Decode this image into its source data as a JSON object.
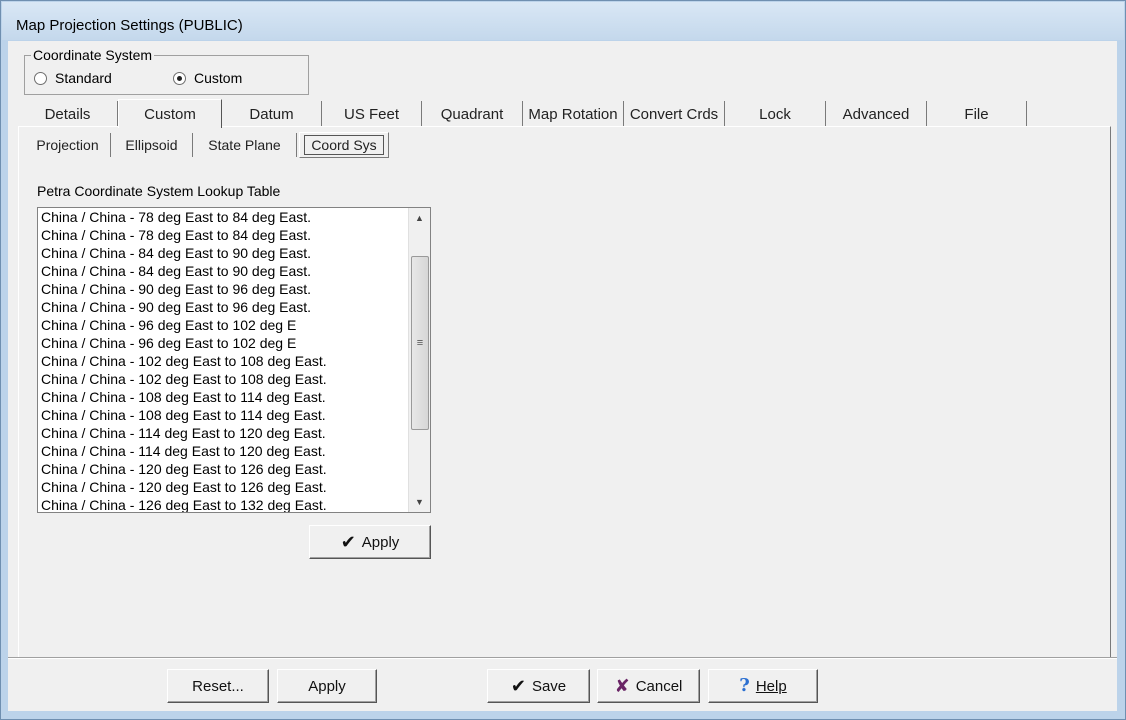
{
  "window": {
    "title": "Map Projection Settings (PUBLIC)"
  },
  "coordinate_system": {
    "label": "Coordinate System",
    "options": [
      {
        "label": "Standard",
        "selected": false
      },
      {
        "label": "Custom",
        "selected": true
      }
    ]
  },
  "tabs": [
    {
      "label": "Details",
      "active": false
    },
    {
      "label": "Custom",
      "active": true
    },
    {
      "label": "Datum",
      "active": false
    },
    {
      "label": "US Feet",
      "active": false
    },
    {
      "label": "Quadrant",
      "active": false
    },
    {
      "label": "Map Rotation",
      "active": false
    },
    {
      "label": "Convert Crds",
      "active": false
    },
    {
      "label": "Lock",
      "active": false
    },
    {
      "label": "Advanced",
      "active": false
    },
    {
      "label": "File",
      "active": false
    }
  ],
  "subtabs": [
    {
      "label": "Projection",
      "active": false
    },
    {
      "label": "Ellipsoid",
      "active": false
    },
    {
      "label": "State Plane",
      "active": false
    },
    {
      "label": "Coord Sys",
      "active": true
    }
  ],
  "lookup": {
    "label": "Petra Coordinate System Lookup Table",
    "items": [
      "China / China - 78 deg East to 84 deg East.",
      "China / China - 78 deg East to 84 deg East.",
      "China / China - 84 deg East to 90 deg East.",
      "China / China - 84 deg East to 90 deg East.",
      "China / China - 90 deg East to 96 deg East.",
      "China / China - 90 deg East to 96 deg East.",
      "China / China - 96 deg East to 102 deg E",
      "China / China - 96 deg East to 102 deg E",
      "China / China - 102 deg East to 108 deg East.",
      "China / China - 102 deg East to 108 deg East.",
      "China / China - 108 deg East to 114 deg East.",
      "China / China - 108 deg East to 114 deg East.",
      "China / China - 114 deg East to 120 deg East.",
      "China / China - 114 deg East to 120 deg East.",
      "China / China - 120 deg East to 126 deg East.",
      "China / China - 120 deg East to 126 deg East.",
      "China / China - 126 deg East to 132 deg East."
    ],
    "apply_label": "Apply"
  },
  "footer": {
    "reset_label": "Reset...",
    "apply_label": "Apply",
    "save_label": "Save",
    "cancel_label": "Cancel",
    "help_label": "Help"
  },
  "icons": {
    "check": "✔",
    "cross": "✘",
    "help": "?"
  }
}
